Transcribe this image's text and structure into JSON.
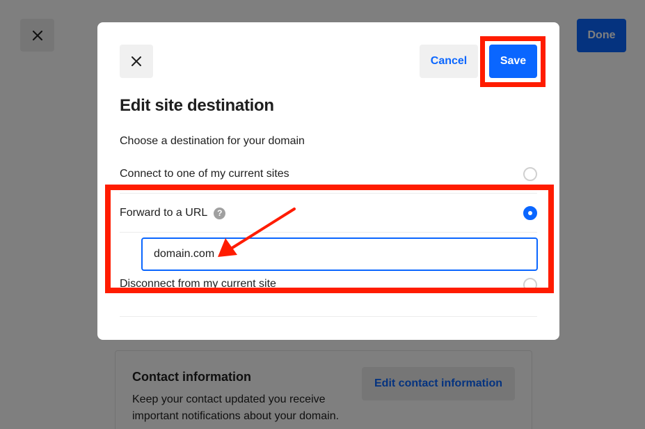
{
  "background": {
    "close_icon": "close-icon",
    "done_label": "Done",
    "contact": {
      "title": "Contact information",
      "description": "Keep your contact updated you receive important notifications about your domain.",
      "edit_label": "Edit contact information"
    }
  },
  "modal": {
    "close_icon": "close-icon",
    "cancel_label": "Cancel",
    "save_label": "Save",
    "title": "Edit site destination",
    "subtitle": "Choose a destination for your domain",
    "options": [
      {
        "label": "Connect to one of my current sites",
        "selected": false
      },
      {
        "label": "Forward to a URL",
        "selected": true,
        "help_icon": "help-icon",
        "help_glyph": "?"
      },
      {
        "label": "Disconnect from my current site",
        "selected": false
      }
    ],
    "url_input": {
      "value": "domain.com",
      "placeholder": ""
    }
  },
  "colors": {
    "accent": "#0a66ff",
    "annotation": "#ff1c00"
  }
}
